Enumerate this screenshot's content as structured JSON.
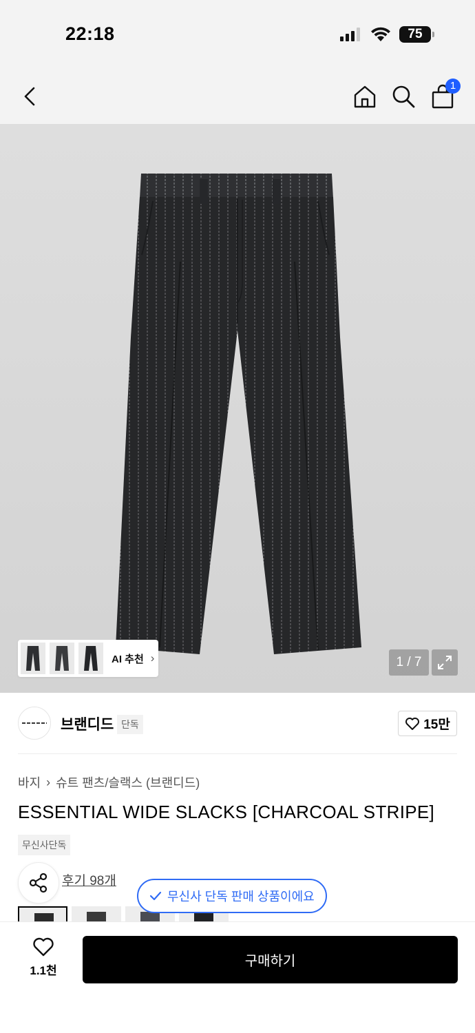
{
  "status_bar": {
    "time": "22:18",
    "battery": "75",
    "icons": [
      "signal-icon",
      "wifi-icon",
      "battery-icon"
    ]
  },
  "nav": {
    "icons": [
      "back-icon",
      "home-icon",
      "search-icon",
      "cart-icon"
    ],
    "cart_count": "1"
  },
  "hero": {
    "ai_label": "AI 추천",
    "ai_chevron": "›",
    "page_indicator": "1 / 7"
  },
  "brand": {
    "name": "브랜디드",
    "exclusive_tag": "단독",
    "like_count": "15만"
  },
  "product": {
    "breadcrumb": [
      "바지",
      "슈트 팬츠/슬랙스 (브랜디드)"
    ],
    "breadcrumb_sep": "›",
    "title": "ESSENTIAL WIDE SLACKS [CHARCOAL STRIPE]",
    "musinsa_tag": "무신사단독",
    "review_link": "후기 98개"
  },
  "toast": {
    "message": "무신사 단독 판매 상품이에요"
  },
  "bottom_bar": {
    "wish_count": "1.1천",
    "buy_label": "구매하기"
  },
  "colors": {
    "accent_blue": "#2f6bf5",
    "badge_blue": "#1f5eff",
    "buy_button": "#000000"
  }
}
